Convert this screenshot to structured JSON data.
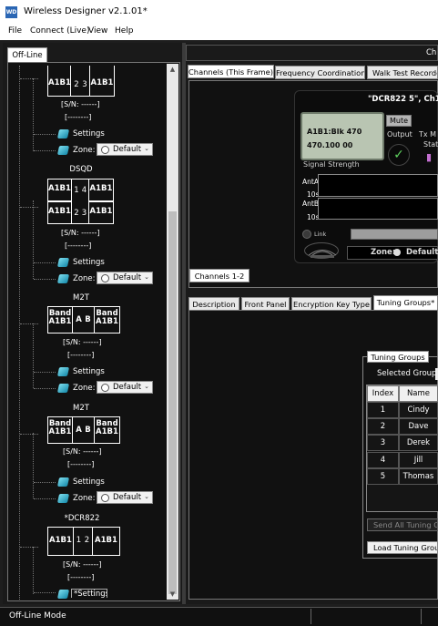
{
  "window": {
    "title": "Wireless Designer v2.1.01*",
    "icon_text": "WD"
  },
  "menu": [
    "File",
    "Connect (Live)",
    "View",
    "Help"
  ],
  "left": {
    "tab": "Off-Line",
    "devices": [
      {
        "title": "",
        "top_row": [
          "A1B1",
          "2",
          "3",
          "A1B1"
        ],
        "sn": "[S/N: ------]",
        "bracket": "[--------]",
        "settings": "Settings",
        "zone_label": "Zone:",
        "zone_value": "Default"
      },
      {
        "title": "DSQD",
        "top_row": [
          "A1B1",
          "1",
          "4",
          "A1B1"
        ],
        "bottom_row": [
          "A1B1",
          "2",
          "3",
          "A1B1"
        ],
        "sn": "[S/N: ------]",
        "bracket": "[--------]",
        "settings": "Settings",
        "zone_label": "Zone:",
        "zone_value": "Default"
      },
      {
        "title": "M2T",
        "cells": [
          "Band A1B1",
          "A",
          "B",
          "Band A1B1"
        ],
        "sn": "[S/N: ------]",
        "bracket": "[--------]",
        "settings": "Settings",
        "zone_label": "Zone:",
        "zone_value": "Default"
      },
      {
        "title": "M2T",
        "cells": [
          "Band A1B1",
          "A",
          "B",
          "Band A1B1"
        ],
        "sn": "[S/N: ------]",
        "bracket": "[--------]",
        "settings": "Settings",
        "zone_label": "Zone:",
        "zone_value": "Default"
      },
      {
        "title": "*DCR822",
        "top_row": [
          "A1B1",
          "1",
          "2",
          "A1B1"
        ],
        "sn": "[S/N: ------]",
        "bracket": "[--------]",
        "settings": "*Settings"
      }
    ]
  },
  "right": {
    "header_ch": "Ch",
    "top_tabs": [
      "Channels (This Frame)",
      "Frequency Coordination",
      "Walk Test Recorder"
    ],
    "device": {
      "name": "\"DCR822 5\", Ch1",
      "lcd_line1": "A1B1:Blk 470",
      "lcd_line2": "470.100   00",
      "mute": "Mute",
      "output": "Output",
      "tx_m": "Tx M",
      "stat": "Stat",
      "signal_strength": "Signal Strength",
      "ant_a": "AntA",
      "ant_b": "AntB",
      "ten_s": "10s",
      "link": "Link",
      "zone_label": "Zone:",
      "zone_value": "Default",
      "logo": "LECTROSONICS"
    },
    "bottom_tab": "Channels 1-2",
    "lower_tabs": [
      "Description",
      "Front Panel",
      "Encryption Key Type",
      "Tuning Groups*"
    ],
    "tuning_groups": {
      "legend": "Tuning Groups",
      "selected_group_label": "Selected Group:",
      "columns": [
        "Index",
        "Name"
      ],
      "rows": [
        {
          "index": "1",
          "name": "Cindy"
        },
        {
          "index": "2",
          "name": "Dave"
        },
        {
          "index": "3",
          "name": "Derek"
        },
        {
          "index": "4",
          "name": "Jill"
        },
        {
          "index": "5",
          "name": "Thomas"
        }
      ],
      "send_all": "Send All Tuning Gro",
      "load": "Load Tuning Group"
    }
  },
  "status": "Off-Line Mode"
}
